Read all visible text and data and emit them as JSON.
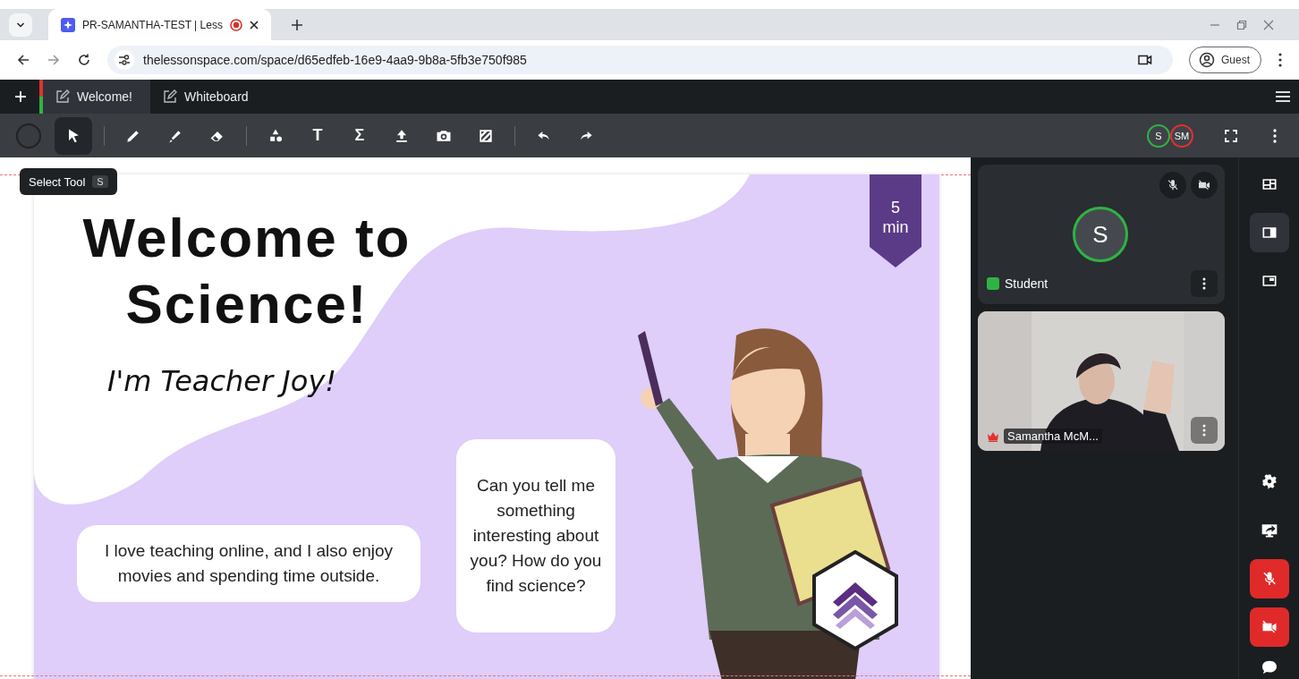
{
  "browser": {
    "tabs": [
      {
        "title": "PR-SAMANTHA-TEST | Less",
        "recording": true,
        "selected": true
      }
    ],
    "url": "thelessonspace.com/space/d65edfeb-16e9-4aa9-9b8a-5fb3e750f985",
    "profile": "Guest"
  },
  "app_tabs": [
    {
      "label": "Welcome!",
      "selected": true
    },
    {
      "label": "Whiteboard",
      "selected": false
    }
  ],
  "tool_groups": [
    [
      {
        "kind": "color",
        "selected": false
      },
      {
        "kind": "select",
        "selected": true
      }
    ],
    [
      {
        "kind": "pencil",
        "selected": false
      },
      {
        "kind": "highlighter",
        "selected": false
      },
      {
        "kind": "eraser",
        "selected": false
      }
    ],
    [
      {
        "kind": "shapes",
        "selected": false
      },
      {
        "kind": "glyph",
        "glyph": "T",
        "selected": false
      },
      {
        "kind": "glyph",
        "glyph": "Σ",
        "selected": false
      },
      {
        "kind": "upload",
        "selected": false
      },
      {
        "kind": "camera",
        "selected": false
      },
      {
        "kind": "background",
        "selected": false
      }
    ],
    [
      {
        "kind": "undo",
        "selected": false
      },
      {
        "kind": "redo",
        "selected": false
      }
    ]
  ],
  "tooltip": {
    "label": "Select Tool",
    "shortcut": "S"
  },
  "participants": [
    {
      "initials": "S",
      "color": "#2fb344"
    },
    {
      "initials": "SM",
      "color": "#e03131"
    }
  ],
  "slide": {
    "title": [
      "Welcome to",
      "Science!"
    ],
    "subtitle": "I'm Teacher Joy!",
    "timer": {
      "value": "5",
      "unit": "min"
    },
    "bubbles": [
      {
        "kind": "wide",
        "text": "I love teaching online, and I also enjoy movies and spending time outside."
      },
      {
        "kind": "tall",
        "text": "Can you tell me something interesting about you? How do you find science?"
      }
    ]
  },
  "video_tiles": [
    {
      "kind": "avatar",
      "initial": "S",
      "name": "Student",
      "mic_off": true,
      "camera_off": true,
      "color": "#2fb344"
    },
    {
      "kind": "video",
      "name": "Samantha McM...",
      "host": true
    }
  ],
  "view_modes": [
    {
      "selected": false
    },
    {
      "selected": true
    },
    {
      "selected": false
    }
  ],
  "controls": {
    "mic_off": true,
    "camera_off": true
  }
}
